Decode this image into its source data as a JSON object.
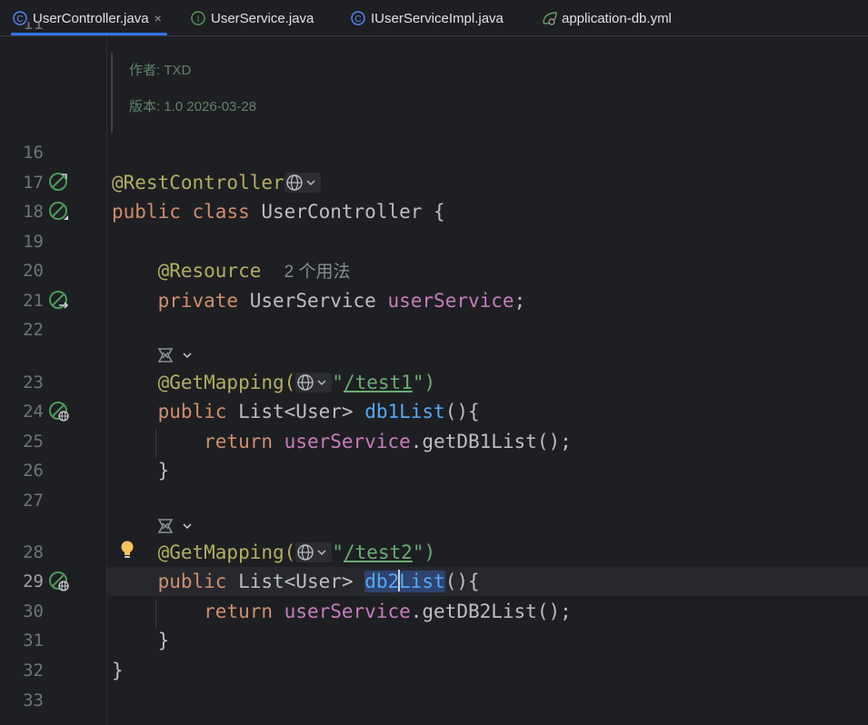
{
  "tabs": [
    {
      "label": "UserController.java",
      "icon": "class-icon",
      "active": true,
      "close": "×"
    },
    {
      "label": "UserService.java",
      "icon": "interface-icon",
      "active": false
    },
    {
      "label": "IUserServiceImpl.java",
      "icon": "class-icon",
      "active": false
    },
    {
      "label": "application-db.yml",
      "icon": "spring-config-icon",
      "active": false
    }
  ],
  "doc": {
    "author": "作者: TXD",
    "version": "版本: 1.0 2026-03-28"
  },
  "line_numbers": [
    "16",
    "17",
    "18",
    "19",
    "20",
    "21",
    "22",
    "23",
    "24",
    "25",
    "26",
    "27",
    "28",
    "29",
    "30",
    "31",
    "32",
    "33"
  ],
  "code": {
    "l17_annotation": "@RestController",
    "l18_public": "public",
    "l18_class": "class",
    "l18_name": "UserController {",
    "l20_annotation": "@Resource",
    "l20_hint": "2 个用法",
    "l21_private": "private",
    "l21_type": "UserService",
    "l21_field": "userService",
    "l21_semicolon": ";",
    "l23_annotation": "@GetMapping(",
    "l23_quote_open": "\"",
    "l23_path": "/test1",
    "l23_close": "\")",
    "l24_public": "public",
    "l24_type": "List<User>",
    "l24_method": "db1List",
    "l24_rest": "(){",
    "l25_return": "return",
    "l25_field": "userService",
    "l25_call": ".getDB1List();",
    "l26_brace": "}",
    "l28_annotation": "@GetMapping(",
    "l28_quote_open": "\"",
    "l28_path": "/test2",
    "l28_close": "\")",
    "l29_public": "public",
    "l29_type": "List<User>",
    "l29_method_a": "db2",
    "l29_method_b": "List",
    "l29_rest": "(){",
    "l30_return": "return",
    "l30_field": "userService",
    "l30_call": ".getDB2List();",
    "l31_brace": "}",
    "l32_brace": "}"
  },
  "current_line": "29",
  "colors": {
    "background": "#1e1f22",
    "keyword": "#cf8e6d",
    "annotation": "#b3ae60",
    "field": "#c77dbb",
    "method": "#56a8f5",
    "string": "#6aab73",
    "tab_underline": "#3574f0",
    "spring_green": "#4d9a5a"
  }
}
